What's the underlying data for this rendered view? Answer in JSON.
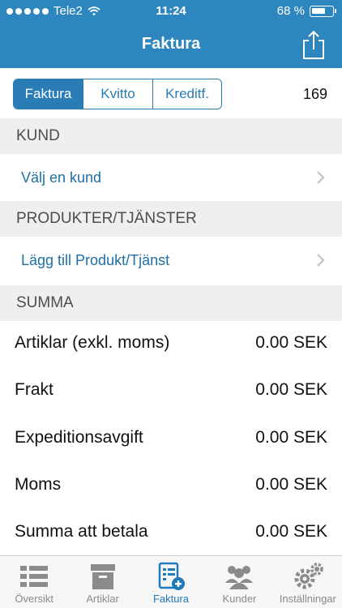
{
  "status": {
    "carrier": "Tele2",
    "time": "11:24",
    "battery": "68 %"
  },
  "nav": {
    "title": "Faktura"
  },
  "segments": [
    "Faktura",
    "Kvitto",
    "Kreditf."
  ],
  "invoice_number": "169",
  "sections": {
    "customer": "KUND",
    "products": "PRODUKTER/TJÄNSTER",
    "summary": "SUMMA"
  },
  "links": {
    "choose_customer": "Välj en kund",
    "add_product": "Lägg till Produkt/Tjänst"
  },
  "summary_rows": [
    {
      "label": "Artiklar (exkl. moms)",
      "value": "0.00 SEK"
    },
    {
      "label": "Frakt",
      "value": "0.00 SEK"
    },
    {
      "label": "Expeditionsavgift",
      "value": "0.00 SEK"
    },
    {
      "label": "Moms",
      "value": "0.00 SEK"
    },
    {
      "label": "Summa att betala",
      "value": "0.00 SEK"
    }
  ],
  "tabs": [
    {
      "label": "Översikt",
      "icon": "list-icon"
    },
    {
      "label": "Artiklar",
      "icon": "box-icon"
    },
    {
      "label": "Faktura",
      "icon": "invoice-add-icon"
    },
    {
      "label": "Kunder",
      "icon": "people-icon"
    },
    {
      "label": "Inställningar",
      "icon": "gears-icon"
    }
  ],
  "colors": {
    "accent": "#2e86bf",
    "active_tab": "#1e7ab8",
    "section_bg": "#efefef",
    "link": "#1d6fa5"
  }
}
